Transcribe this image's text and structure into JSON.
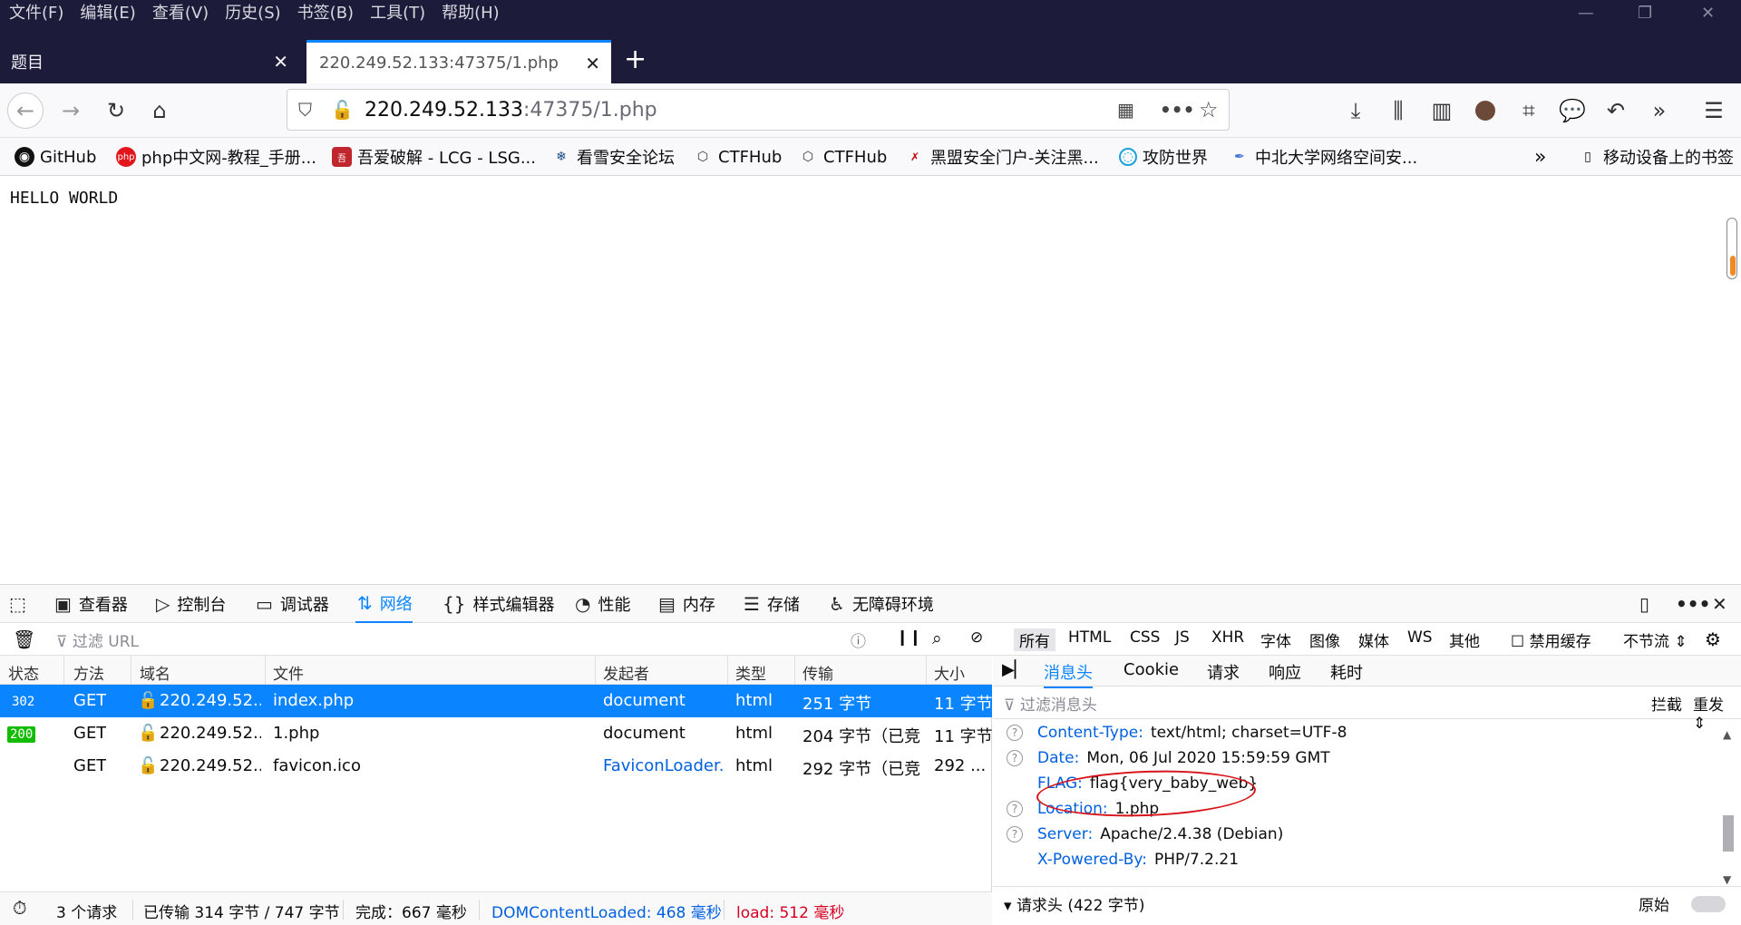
{
  "menubar": [
    "文件(F)",
    "编辑(E)",
    "查看(V)",
    "历史(S)",
    "书签(B)",
    "工具(T)",
    "帮助(H)"
  ],
  "tabs": [
    {
      "label": "题目"
    },
    {
      "label": "220.249.52.133:47375/1.php"
    }
  ],
  "url": {
    "host": "220.249.52.133",
    "rest": ":47375/1.php"
  },
  "bookmarks": [
    {
      "label": "GitHub",
      "icon": "github-icon"
    },
    {
      "label": "php中文网-教程_手册...",
      "icon": "php-icon"
    },
    {
      "label": "吾爱破解 - LCG - LSG...",
      "icon": "52pojie-icon"
    },
    {
      "label": "看雪安全论坛",
      "icon": "snowflake-icon"
    },
    {
      "label": "CTFHub",
      "icon": "cube-icon"
    },
    {
      "label": "CTFHub",
      "icon": "cube-icon"
    },
    {
      "label": "黑盟安全门户-关注黑...",
      "icon": "hm-icon"
    },
    {
      "label": "攻防世界",
      "icon": "globe-icon"
    },
    {
      "label": "中北大学网络空间安...",
      "icon": "feather-icon"
    },
    {
      "label": "移动设备上的书签",
      "icon": "mobile-icon"
    }
  ],
  "page": {
    "content": "HELLO WORLD"
  },
  "devtools": {
    "tabs": [
      "查看器",
      "控制台",
      "调试器",
      "网络",
      "样式编辑器",
      "性能",
      "内存",
      "存储",
      "无障碍环境"
    ],
    "filter_placeholder": "过滤 URL",
    "type_filters": [
      "所有",
      "HTML",
      "CSS",
      "JS",
      "XHR",
      "字体",
      "图像",
      "媒体",
      "WS",
      "其他"
    ],
    "disable_cache": "禁用缓存",
    "throttle": "不节流 ⇕",
    "columns": [
      "状态",
      "方法",
      "域名",
      "文件",
      "发起者",
      "类型",
      "传输",
      "大小"
    ],
    "requests": [
      {
        "status": "302",
        "method": "GET",
        "domain": "220.249.52....",
        "file": "index.php",
        "initiator": "document",
        "type": "html",
        "transfer": "251 字节",
        "size": "11 字节"
      },
      {
        "status": "200",
        "method": "GET",
        "domain": "220.249.52....",
        "file": "1.php",
        "initiator": "document",
        "type": "html",
        "transfer": "204 字节（已竞...",
        "size": "11 字节"
      },
      {
        "status": "",
        "method": "GET",
        "domain": "220.249.52....",
        "file": "favicon.ico",
        "initiator": "FaviconLoader...",
        "type": "html",
        "transfer": "292 字节（已竞...",
        "size": "292 ..."
      }
    ],
    "status_bar": {
      "requests": "3 个请求",
      "transferred": "已传输 314 字节 / 747 字节",
      "finish": "完成：667 毫秒",
      "dcl": "DOMContentLoaded: 468 毫秒",
      "load": "load: 512 毫秒"
    },
    "detail_tabs": [
      "消息头",
      "Cookie",
      "请求",
      "响应",
      "耗时"
    ],
    "headers_filter": "过滤消息头",
    "block": "拦截",
    "resend": "重发 ⇕",
    "headers": [
      {
        "key": "Content-Type:",
        "value": "text/html; charset=UTF-8"
      },
      {
        "key": "Date:",
        "value": "Mon, 06 Jul 2020 15:59:59 GMT"
      },
      {
        "key": "FLAG:",
        "value": "flag{very_baby_web}"
      },
      {
        "key": "Location:",
        "value": "1.php"
      },
      {
        "key": "Server:",
        "value": "Apache/2.4.38 (Debian)"
      },
      {
        "key": "X-Powered-By:",
        "value": "PHP/7.2.21"
      }
    ],
    "request_headers": "请求头 (422 字节)",
    "raw": "原始"
  },
  "colors": {
    "accent": "#0a84ff",
    "ok": "#12bc00",
    "error_circle": "#d8141a"
  }
}
